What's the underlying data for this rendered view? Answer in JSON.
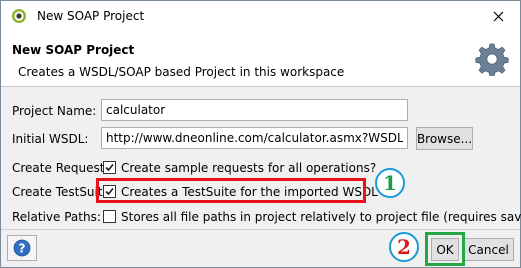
{
  "window": {
    "title": "New SOAP Project"
  },
  "header": {
    "title": "New SOAP Project",
    "subtitle": "Creates a WSDL/SOAP based Project in this workspace",
    "icon": "gear-icon"
  },
  "form": {
    "project_name": {
      "label": "Project Name:",
      "value": "calculator"
    },
    "initial_wsdl": {
      "label": "Initial WSDL:",
      "value": "http://www.dneonline.com/calculator.asmx?WSDL",
      "browse_label": "Browse..."
    },
    "create_requests": {
      "label": "Create Requests:",
      "checkbox_label": "Create sample requests for all operations?",
      "checked": true
    },
    "create_testsuite": {
      "label": "Create TestSuite",
      "checkbox_label": "Creates a TestSuite for the imported WSDL",
      "checked": true
    },
    "relative_paths": {
      "label": "Relative Paths:",
      "checkbox_label": "Stores all file paths in project relatively to project file (requires save)",
      "checked": false
    }
  },
  "footer": {
    "ok_label": "OK",
    "cancel_label": "Cancel",
    "help_icon": "help-icon"
  },
  "annotations": {
    "step1": "1",
    "step2": "2",
    "colors": {
      "red": "#e8121c",
      "green": "#25a843",
      "blue": "#1a9bd7"
    }
  }
}
